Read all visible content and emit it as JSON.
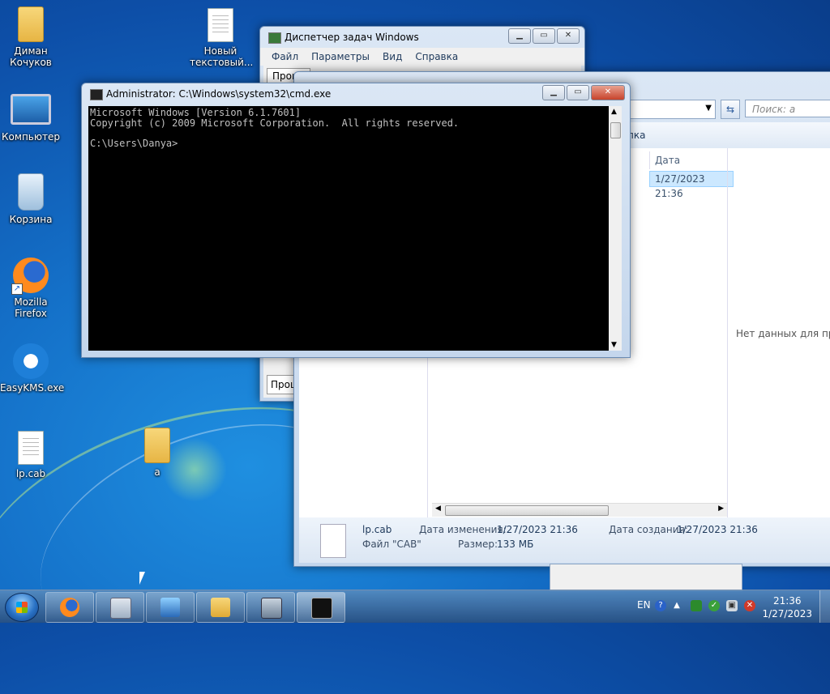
{
  "desktop": {
    "icons": [
      {
        "label": "Диман\nКочуков",
        "icon": "user-folder-icon"
      },
      {
        "label": "Новый\nтекстовый...",
        "icon": "text-document-icon"
      },
      {
        "label": "Компьютер",
        "icon": "computer-icon"
      },
      {
        "label": "Корзина",
        "icon": "recycle-bin-icon"
      },
      {
        "label": "Mozilla\nFirefox",
        "icon": "firefox-icon"
      },
      {
        "label": "EasyKMS.exe",
        "icon": "easykms-icon"
      },
      {
        "label": "lp.cab",
        "icon": "file-icon"
      },
      {
        "label": "a",
        "icon": "folder-icon"
      }
    ]
  },
  "taskmgr": {
    "title": "Диспетчер задач Windows",
    "menu": [
      "Файл",
      "Параметры",
      "Вид",
      "Справка"
    ],
    "tab_top": "Проце",
    "tab_bottom": "Проце"
  },
  "explorer": {
    "search_placeholder": "Поиск: a",
    "cmd_fragment": "пка",
    "col_header": "Дата изменения",
    "row_date": "1/27/2023 21:36",
    "preview_text": "Нет данных для предва",
    "details": {
      "name": "lp.cab",
      "type": "Файл \"CAB\"",
      "modified_label": "Дата изменения:",
      "modified_value": "1/27/2023 21:36",
      "size_label": "Размер:",
      "size_value": "133 МБ",
      "created_label": "Дата создания:",
      "created_value": "1/27/2023 21:36"
    }
  },
  "cmd": {
    "title": "Administrator: C:\\Windows\\system32\\cmd.exe",
    "lines": "Microsoft Windows [Version 6.1.7601]\nCopyright (c) 2009 Microsoft Corporation.  All rights reserved.\n\nC:\\Users\\Danya>"
  },
  "taskbar": {
    "language": "EN",
    "time": "21:36",
    "date": "1/27/2023"
  }
}
